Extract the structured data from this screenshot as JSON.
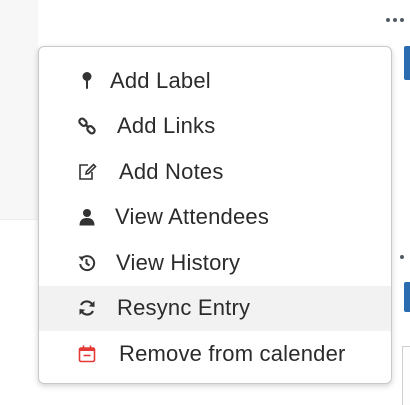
{
  "menu": {
    "items": [
      {
        "label": "Add Label",
        "icon": "pin-icon"
      },
      {
        "label": "Add Links",
        "icon": "link-icon"
      },
      {
        "label": "Add Notes",
        "icon": "edit-note-icon"
      },
      {
        "label": "View Attendees",
        "icon": "user-icon"
      },
      {
        "label": "View History",
        "icon": "history-icon"
      },
      {
        "label": "Resync Entry",
        "icon": "sync-icon",
        "highlighted": true
      },
      {
        "label": "Remove from calender",
        "icon": "calendar-remove-icon",
        "color": "#e53935"
      }
    ]
  },
  "colors": {
    "text": "#2b2b2b",
    "icon": "#333333",
    "danger": "#e53935",
    "hover_bg": "#f2f2f2",
    "accent": "#2b6cb0"
  }
}
